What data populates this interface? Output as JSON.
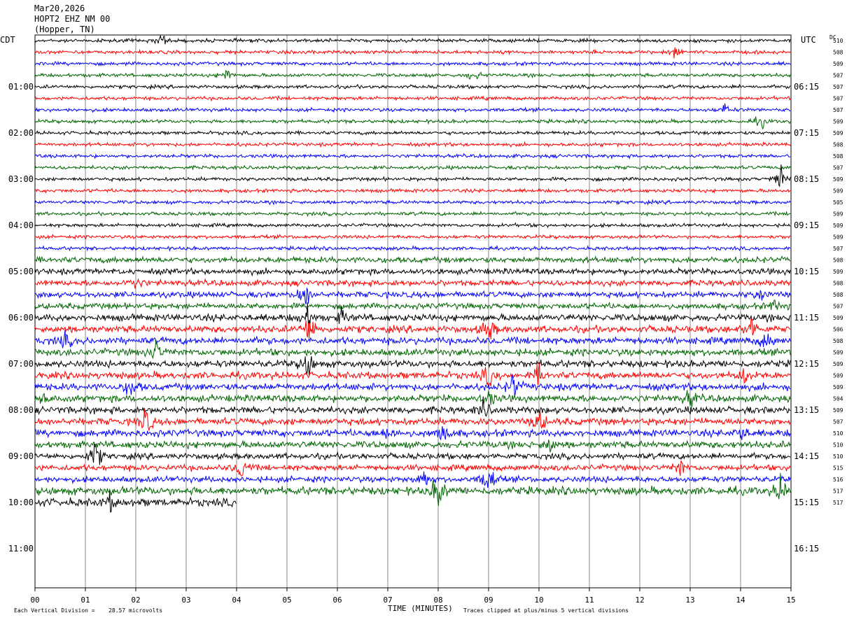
{
  "header": {
    "date": "Mar20,2026",
    "station": "HOPT2 EHZ NM 00",
    "location": "(Hopper, TN)",
    "left_tz": "CDT",
    "right_tz": "UTC",
    "dc_label": "DC"
  },
  "footer": {
    "scale_label": "Each Vertical Division =",
    "scale_value": "28.57 microvolts",
    "xlabel": "TIME (MINUTES)",
    "clip_note": "Traces clipped at plus/minus 5 vertical divisions"
  },
  "chart_data": {
    "type": "line",
    "title": "HOPT2 EHZ NM 00",
    "xlabel": "TIME (MINUTES)",
    "xlim": [
      0,
      15
    ],
    "x_ticks": [
      "00",
      "01",
      "02",
      "03",
      "04",
      "05",
      "06",
      "07",
      "08",
      "09",
      "10",
      "11",
      "12",
      "13",
      "14",
      "15"
    ],
    "trace_colors": [
      "#000000",
      "#ff0000",
      "#0000ff",
      "#006400"
    ],
    "grid": true,
    "rows_per_hour": 4,
    "minutes_per_row": 15,
    "row_count": 41,
    "left_hour_labels": [
      "01:00",
      "02:00",
      "03:00",
      "04:00",
      "05:00",
      "06:00",
      "07:00",
      "08:00",
      "09:00",
      "10:00",
      "11:00"
    ],
    "right_hour_labels": [
      "06:15",
      "07:15",
      "08:15",
      "09:15",
      "10:15",
      "11:15",
      "12:15",
      "13:15",
      "14:15",
      "15:15",
      "16:15"
    ],
    "dc_offsets": [
      "510",
      "508",
      "509",
      "507",
      "507",
      "507",
      "507",
      "509",
      "509",
      "508",
      "508",
      "507",
      "509",
      "509",
      "505",
      "509",
      "509",
      "509",
      "507",
      "508",
      "509",
      "508",
      "508",
      "507",
      "509",
      "506",
      "508",
      "509",
      "509",
      "509",
      "509",
      "504",
      "509",
      "507",
      "510",
      "510",
      "510",
      "515",
      "516",
      "517",
      "517"
    ],
    "last_row_minutes": 4.0,
    "activity": [
      {
        "row": 0,
        "minute": 2.5,
        "amp": 1.5
      },
      {
        "row": 1,
        "minute": 12.7,
        "amp": 1.4
      },
      {
        "row": 3,
        "minute": 3.8,
        "amp": 1.5
      },
      {
        "row": 3,
        "minute": 8.7,
        "amp": 1.5
      },
      {
        "row": 6,
        "minute": 13.7,
        "amp": 1.4
      },
      {
        "row": 7,
        "minute": 14.4,
        "amp": 1.5
      },
      {
        "row": 12,
        "minute": 14.8,
        "amp": 2.8
      },
      {
        "row": 21,
        "minute": 2.0,
        "amp": 1.5
      },
      {
        "row": 22,
        "minute": 5.35,
        "amp": 3.5
      },
      {
        "row": 22,
        "minute": 14.4,
        "amp": 1.6
      },
      {
        "row": 23,
        "minute": 14.7,
        "amp": 1.6
      },
      {
        "row": 24,
        "minute": 5.4,
        "amp": 3.0
      },
      {
        "row": 24,
        "minute": 6.1,
        "amp": 1.7
      },
      {
        "row": 25,
        "minute": 5.45,
        "amp": 4.0
      },
      {
        "row": 25,
        "minute": 9.0,
        "amp": 3.0
      },
      {
        "row": 25,
        "minute": 14.2,
        "amp": 3.0
      },
      {
        "row": 26,
        "minute": 0.6,
        "amp": 1.5
      },
      {
        "row": 26,
        "minute": 14.5,
        "amp": 2.5
      },
      {
        "row": 27,
        "minute": 2.4,
        "amp": 2.5
      },
      {
        "row": 28,
        "minute": 5.4,
        "amp": 3.5
      },
      {
        "row": 29,
        "minute": 9.0,
        "amp": 2.5
      },
      {
        "row": 29,
        "minute": 10.0,
        "amp": 2.0
      },
      {
        "row": 29,
        "minute": 14.1,
        "amp": 2.0
      },
      {
        "row": 30,
        "minute": 1.9,
        "amp": 2.5
      },
      {
        "row": 30,
        "minute": 9.5,
        "amp": 3.0
      },
      {
        "row": 31,
        "minute": 0.1,
        "amp": 2.0
      },
      {
        "row": 31,
        "minute": 9.0,
        "amp": 2.0
      },
      {
        "row": 31,
        "minute": 13.0,
        "amp": 2.0
      },
      {
        "row": 32,
        "minute": 8.9,
        "amp": 2.0
      },
      {
        "row": 33,
        "minute": 2.2,
        "amp": 3.5
      },
      {
        "row": 33,
        "minute": 10.0,
        "amp": 3.0
      },
      {
        "row": 34,
        "minute": 7.0,
        "amp": 2.0
      },
      {
        "row": 34,
        "minute": 8.1,
        "amp": 2.5
      },
      {
        "row": 34,
        "minute": 14.0,
        "amp": 2.0
      },
      {
        "row": 35,
        "minute": 10.2,
        "amp": 2.0
      },
      {
        "row": 36,
        "minute": 1.2,
        "amp": 3.5
      },
      {
        "row": 37,
        "minute": 4.1,
        "amp": 3.0
      },
      {
        "row": 37,
        "minute": 12.8,
        "amp": 2.0
      },
      {
        "row": 38,
        "minute": 7.7,
        "amp": 2.5
      },
      {
        "row": 38,
        "minute": 9.0,
        "amp": 4.5
      },
      {
        "row": 39,
        "minute": 8.0,
        "amp": 4.0
      },
      {
        "row": 39,
        "minute": 14.8,
        "amp": 3.0
      },
      {
        "row": 40,
        "minute": 1.5,
        "amp": 1.6
      }
    ]
  }
}
